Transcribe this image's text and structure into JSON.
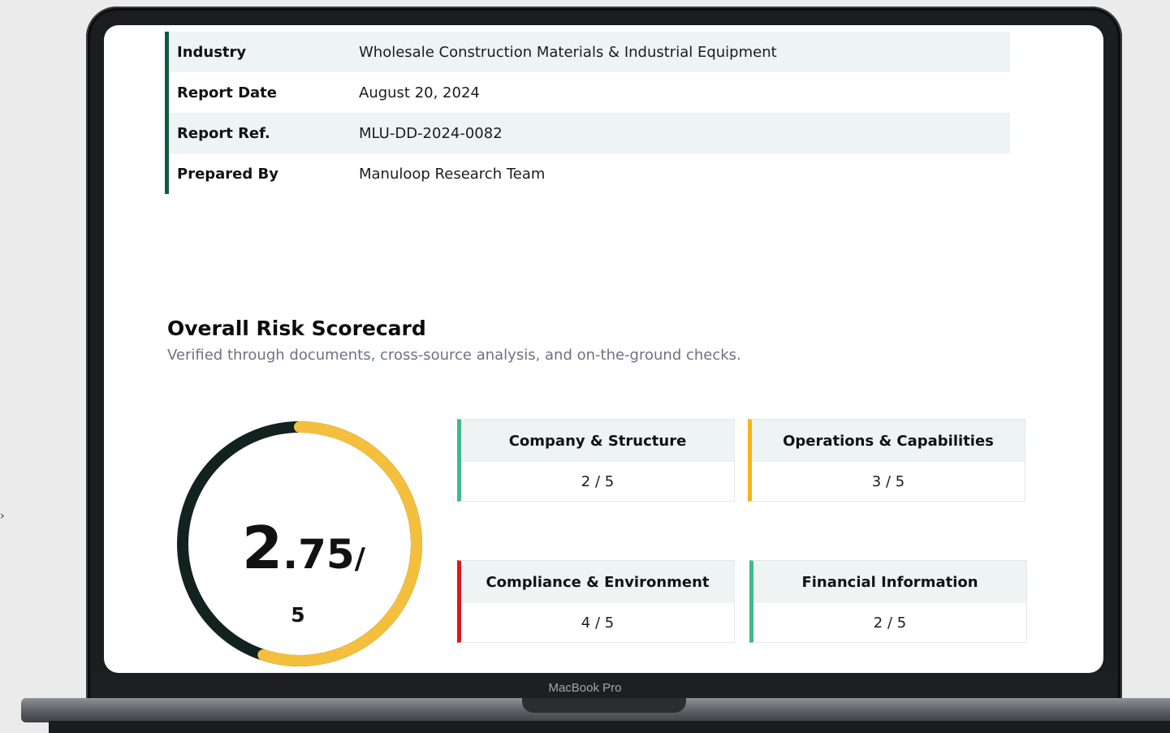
{
  "details": [
    {
      "label": "Industry",
      "value": "Wholesale Construction Materials & Industrial Equipment"
    },
    {
      "label": "Report Date",
      "value": "August 20, 2024"
    },
    {
      "label": "Report Ref.",
      "value": "MLU-DD-2024-0082"
    },
    {
      "label": "Prepared By",
      "value": "Manuloop Research Team"
    }
  ],
  "scorecard": {
    "title": "Overall Risk Scorecard",
    "subtitle": "Verified through documents, cross-source analysis, and on-the-ground checks.",
    "overall_integer": "2",
    "overall_decimal": ".75",
    "overall_slash": "/",
    "overall_max": "5",
    "overall_value": 2.75,
    "overall_out_of": 5,
    "colors": {
      "track": "#12221e",
      "fill": "#f4bf3c"
    }
  },
  "categories": [
    {
      "name": "Company & Structure",
      "score": "2 / 5",
      "accent": "#3dba8a"
    },
    {
      "name": "Operations & Capabilities",
      "score": "3 / 5",
      "accent": "#f2b51a"
    },
    {
      "name": "Compliance & Environment",
      "score": "4 / 5",
      "accent": "#e0161c"
    },
    {
      "name": "Financial Information",
      "score": "2 / 5",
      "accent": "#3dba8a"
    }
  ],
  "device": {
    "model": "MacBook Pro"
  }
}
